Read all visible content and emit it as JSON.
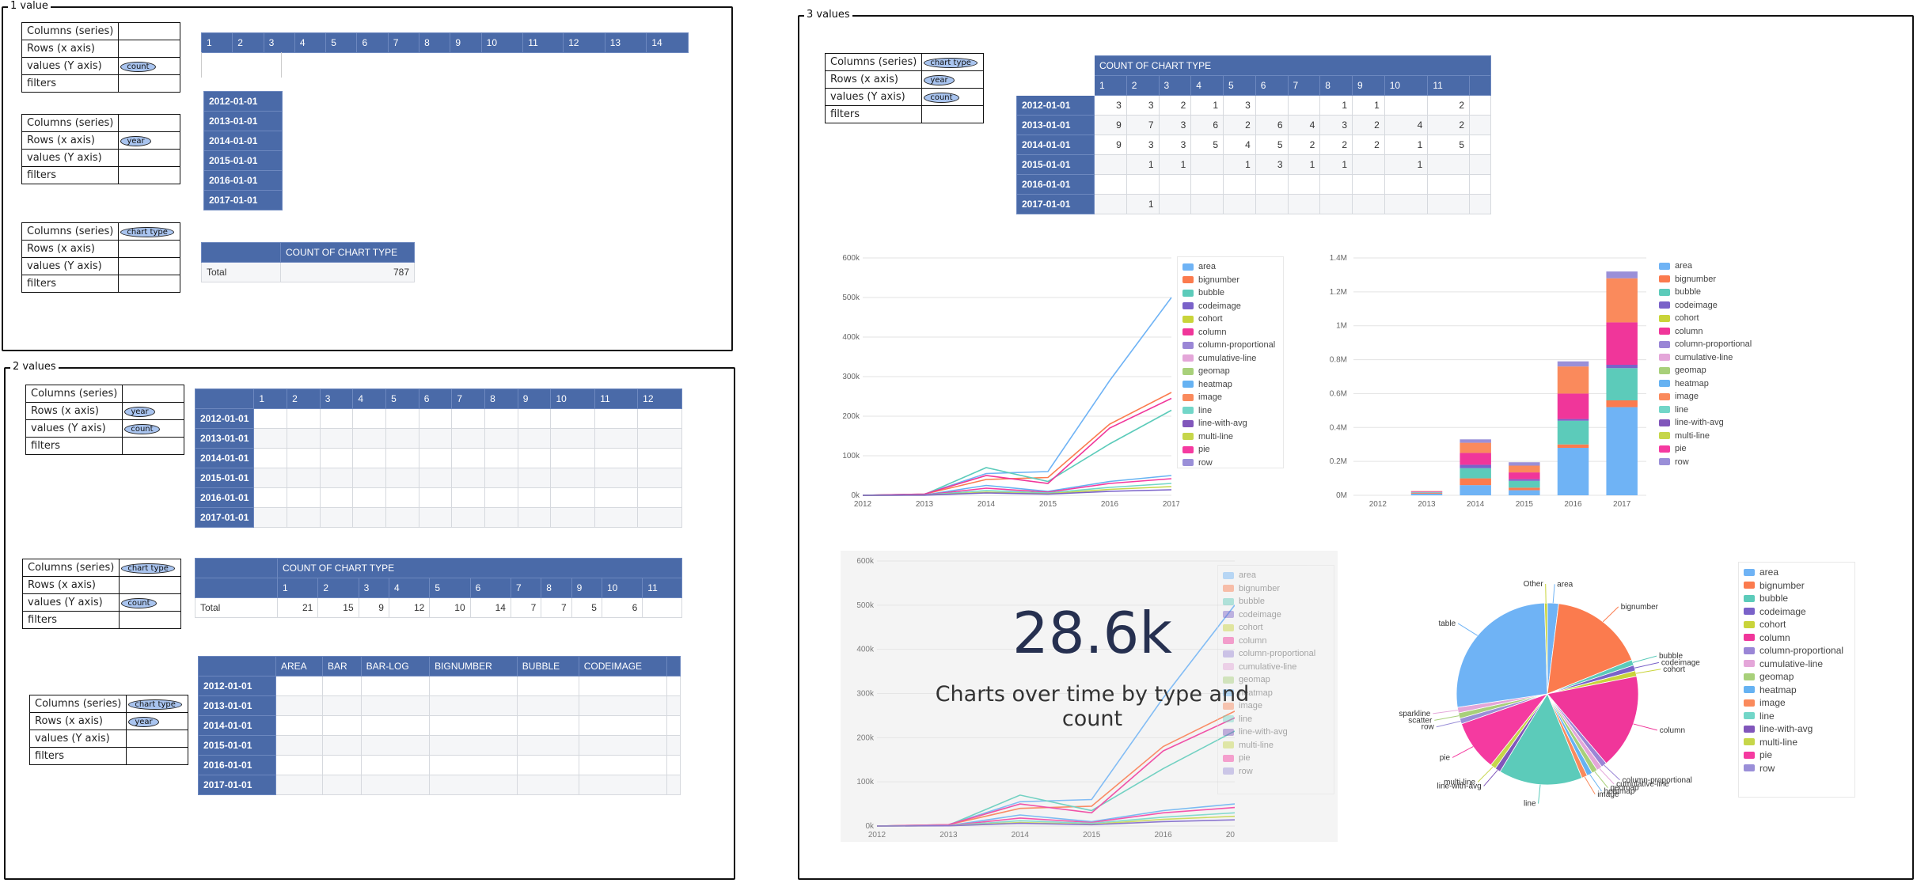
{
  "frames": {
    "one": "1 value",
    "two": "2 values",
    "three": "3 values"
  },
  "cfg_labels": {
    "columns": "Columns (series)",
    "rows": "Rows (x axis)",
    "values": "values (Y axis)",
    "filters": "filters"
  },
  "pills": {
    "count": "count",
    "year": "year",
    "chart_type": "chart type"
  },
  "years": [
    "2012-01-01",
    "2013-01-01",
    "2014-01-01",
    "2015-01-01",
    "2016-01-01",
    "2017-01-01"
  ],
  "nums14": [
    "1",
    "2",
    "3",
    "4",
    "5",
    "6",
    "7",
    "8",
    "9",
    "10",
    "11",
    "12",
    "13",
    "14"
  ],
  "nums12": [
    "1",
    "2",
    "3",
    "4",
    "5",
    "6",
    "7",
    "8",
    "9",
    "10",
    "11",
    "12"
  ],
  "nums11": [
    "1",
    "2",
    "3",
    "4",
    "5",
    "6",
    "7",
    "8",
    "9",
    "10",
    "11"
  ],
  "total_table": {
    "header": "COUNT OF CHART TYPE",
    "row_label": "Total",
    "value": "787"
  },
  "two_total_table": {
    "header": "COUNT OF CHART TYPE",
    "row_label": "Total",
    "values": [
      "21",
      "15",
      "9",
      "12",
      "10",
      "14",
      "7",
      "7",
      "5",
      "6",
      ""
    ]
  },
  "named_cols": [
    "AREA",
    "BAR",
    "BAR-LOG",
    "BIGNUMBER",
    "BUBBLE",
    "CODEIMAGE"
  ],
  "three_table": {
    "header": "COUNT OF CHART TYPE",
    "rows": [
      [
        "3",
        "3",
        "2",
        "1",
        "3",
        "",
        "",
        "1",
        "1",
        "",
        "2"
      ],
      [
        "9",
        "7",
        "3",
        "6",
        "2",
        "6",
        "4",
        "3",
        "2",
        "4",
        "2"
      ],
      [
        "9",
        "3",
        "3",
        "5",
        "4",
        "5",
        "2",
        "2",
        "2",
        "1",
        "5"
      ],
      [
        "",
        "1",
        "1",
        "",
        "1",
        "3",
        "1",
        "1",
        "",
        "1",
        ""
      ],
      [
        "",
        "",
        "",
        "",
        "",
        "",
        "",
        "",
        "",
        "",
        ""
      ],
      [
        "",
        "1",
        "",
        "",
        "",
        "",
        "",
        "",
        "",
        "",
        ""
      ]
    ]
  },
  "big_number": {
    "value": "28.6k",
    "caption": "Charts over time by type and count"
  },
  "series_names": [
    "area",
    "bignumber",
    "bubble",
    "codeimage",
    "cohort",
    "column",
    "column-proportional",
    "cumulative-line",
    "geomap",
    "heatmap",
    "image",
    "line",
    "line-with-avg",
    "multi-line",
    "pie",
    "row"
  ],
  "colors": [
    "#6fb3f5",
    "#fb7b4e",
    "#5ccbba",
    "#7a62c9",
    "#c9d43a",
    "#f0369a",
    "#9a86d6",
    "#e4a6d9",
    "#a8d07a",
    "#66b2f2",
    "#fa8a5c",
    "#72d6c8",
    "#8156bb",
    "#c6d64a",
    "#f53aa0",
    "#9a8fd8"
  ],
  "chart_data": [
    {
      "type": "line",
      "x": [
        "2012",
        "2013",
        "2014",
        "2015",
        "2016",
        "2017"
      ],
      "ylim": [
        0,
        600000
      ],
      "yticks": [
        "0k",
        "100k",
        "200k",
        "300k",
        "400k",
        "500k",
        "600k"
      ],
      "series": [
        {
          "name": "area",
          "values": [
            0,
            3000,
            55000,
            60000,
            290000,
            500000
          ]
        },
        {
          "name": "bignumber",
          "values": [
            0,
            3000,
            40000,
            45000,
            180000,
            260000
          ]
        },
        {
          "name": "bubble",
          "values": [
            0,
            2000,
            70000,
            35000,
            130000,
            215000
          ]
        },
        {
          "name": "column",
          "values": [
            0,
            3000,
            50000,
            30000,
            170000,
            245000
          ]
        },
        {
          "name": "heatmap",
          "values": [
            0,
            1000,
            25000,
            10000,
            35000,
            50000
          ]
        },
        {
          "name": "pie",
          "values": [
            0,
            1000,
            18000,
            8000,
            30000,
            42000
          ]
        },
        {
          "name": "line",
          "values": [
            0,
            1000,
            12000,
            6000,
            20000,
            30000
          ]
        },
        {
          "name": "multi-line",
          "values": [
            0,
            500,
            8000,
            4000,
            15000,
            22000
          ]
        },
        {
          "name": "codeimage",
          "values": [
            0,
            500,
            6000,
            3000,
            10000,
            14000
          ]
        }
      ]
    },
    {
      "type": "bar",
      "stacked": true,
      "categories": [
        "2012",
        "2013",
        "2014",
        "2015",
        "2016",
        "2017"
      ],
      "ylim": [
        0,
        1400000
      ],
      "yticks": [
        "0M",
        "0.2M",
        "0.4M",
        "0.6M",
        "0.8M",
        "1M",
        "1.2M",
        "1.4M"
      ],
      "series": [
        {
          "name": "area",
          "values": [
            0,
            10000,
            60000,
            30000,
            280000,
            520000
          ]
        },
        {
          "name": "bignumber",
          "values": [
            0,
            5000,
            40000,
            15000,
            20000,
            40000
          ]
        },
        {
          "name": "bubble",
          "values": [
            0,
            3000,
            60000,
            40000,
            140000,
            190000
          ]
        },
        {
          "name": "codeimage",
          "values": [
            0,
            2000,
            20000,
            10000,
            10000,
            20000
          ]
        },
        {
          "name": "column",
          "values": [
            0,
            3000,
            70000,
            40000,
            150000,
            250000
          ]
        },
        {
          "name": "image",
          "values": [
            0,
            2000,
            60000,
            40000,
            160000,
            260000
          ]
        },
        {
          "name": "row",
          "values": [
            0,
            0,
            20000,
            20000,
            30000,
            40000
          ]
        }
      ]
    },
    {
      "type": "pie",
      "slices": [
        {
          "label": "area",
          "value": 2
        },
        {
          "label": "bignumber",
          "value": 17
        },
        {
          "label": "bubble",
          "value": 1
        },
        {
          "label": "codeimage",
          "value": 1
        },
        {
          "label": "cohort",
          "value": 1
        },
        {
          "label": "column",
          "value": 17
        },
        {
          "label": "column-proportional",
          "value": 1
        },
        {
          "label": "cumulative-line",
          "value": 1
        },
        {
          "label": "geomap",
          "value": 1
        },
        {
          "label": "heatmap",
          "value": 1
        },
        {
          "label": "image",
          "value": 1
        },
        {
          "label": "line",
          "value": 15
        },
        {
          "label": "line-with-avg",
          "value": 1
        },
        {
          "label": "multi-line",
          "value": 1
        },
        {
          "label": "pie",
          "value": 9
        },
        {
          "label": "row",
          "value": 1
        },
        {
          "label": "scatter",
          "value": 1
        },
        {
          "label": "sparkline",
          "value": 1
        },
        {
          "label": "table",
          "value": 27
        },
        {
          "label": "Other",
          "value": 0.5
        }
      ]
    }
  ]
}
